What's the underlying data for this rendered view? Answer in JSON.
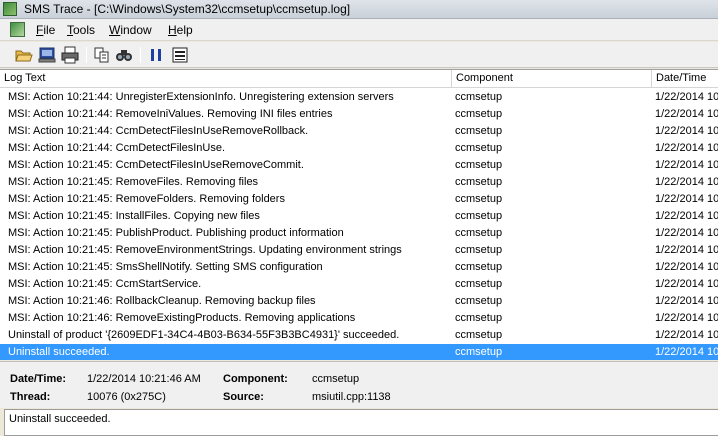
{
  "window": {
    "title": "SMS Trace - [C:\\Windows\\System32\\ccmsetup\\ccmsetup.log]"
  },
  "menu": [
    "File",
    "Tools",
    "Window",
    "Help"
  ],
  "toolbar": [
    "open-icon",
    "print-preview-icon",
    "print-icon",
    "copy-icon",
    "find-icon",
    "pause-icon",
    "highlight-icon"
  ],
  "list": {
    "columns": [
      "Log Text",
      "Component",
      "Date/Time"
    ],
    "rows": [
      {
        "text": "MSI: Action 10:21:44: UnregisterExtensionInfo. Unregistering extension servers",
        "component": "ccmsetup",
        "date": "1/22/2014 10"
      },
      {
        "text": "MSI: Action 10:21:44: RemoveIniValues. Removing INI files entries",
        "component": "ccmsetup",
        "date": "1/22/2014 10"
      },
      {
        "text": "MSI: Action 10:21:44: CcmDetectFilesInUseRemoveRollback.",
        "component": "ccmsetup",
        "date": "1/22/2014 10"
      },
      {
        "text": "MSI: Action 10:21:44: CcmDetectFilesInUse.",
        "component": "ccmsetup",
        "date": "1/22/2014 10"
      },
      {
        "text": "MSI: Action 10:21:45: CcmDetectFilesInUseRemoveCommit.",
        "component": "ccmsetup",
        "date": "1/22/2014 10"
      },
      {
        "text": "MSI: Action 10:21:45: RemoveFiles. Removing files",
        "component": "ccmsetup",
        "date": "1/22/2014 10"
      },
      {
        "text": "MSI: Action 10:21:45: RemoveFolders. Removing folders",
        "component": "ccmsetup",
        "date": "1/22/2014 10"
      },
      {
        "text": "MSI: Action 10:21:45: InstallFiles. Copying new files",
        "component": "ccmsetup",
        "date": "1/22/2014 10"
      },
      {
        "text": "MSI: Action 10:21:45: PublishProduct. Publishing product information",
        "component": "ccmsetup",
        "date": "1/22/2014 10"
      },
      {
        "text": "MSI: Action 10:21:45: RemoveEnvironmentStrings. Updating environment strings",
        "component": "ccmsetup",
        "date": "1/22/2014 10"
      },
      {
        "text": "MSI: Action 10:21:45: SmsShellNotify. Setting SMS configuration",
        "component": "ccmsetup",
        "date": "1/22/2014 10"
      },
      {
        "text": "MSI: Action 10:21:45: CcmStartService.",
        "component": "ccmsetup",
        "date": "1/22/2014 10"
      },
      {
        "text": "MSI: Action 10:21:46: RollbackCleanup. Removing backup files",
        "component": "ccmsetup",
        "date": "1/22/2014 10"
      },
      {
        "text": "MSI: Action 10:21:46: RemoveExistingProducts. Removing applications",
        "component": "ccmsetup",
        "date": "1/22/2014 10"
      },
      {
        "text": "Uninstall of product '{2609EDF1-34C4-4B03-B634-55F3B3BC4931}' succeeded.",
        "component": "ccmsetup",
        "date": "1/22/2014 10"
      },
      {
        "text": "Uninstall succeeded.",
        "component": "ccmsetup",
        "date": "1/22/2014 10",
        "selected": true
      }
    ]
  },
  "details": {
    "datetime_label": "Date/Time:",
    "datetime_value": "1/22/2014 10:21:46 AM",
    "component_label": "Component:",
    "component_value": "ccmsetup",
    "thread_label": "Thread:",
    "thread_value": "10076 (0x275C)",
    "source_label": "Source:",
    "source_value": "msiutil.cpp:1138"
  },
  "message": "Uninstall succeeded.",
  "colors": {
    "selection": "#3399ff"
  }
}
